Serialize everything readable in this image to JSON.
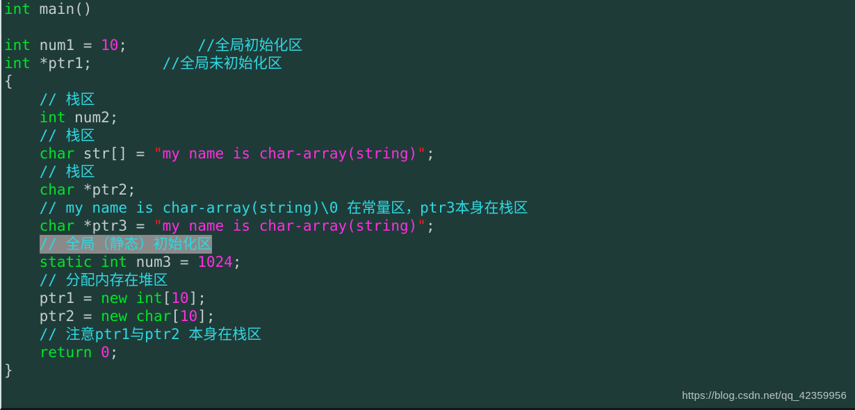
{
  "editor": {
    "language": "cpp",
    "background_color": "#1f3b38",
    "colors": {
      "keyword": "#00e52a",
      "identifier": "#c3cfcd",
      "number": "#ff2fe0",
      "string": "#ff2fe0",
      "quote": "#ff1a1a",
      "comment": "#2fd8e0",
      "selection": "#8a8a8a"
    }
  },
  "watermark": {
    "text": "https://blog.csdn.net/qq_42359956"
  },
  "code": {
    "lines": [
      {
        "n": 1,
        "highlight": false,
        "tokens": [
          {
            "t": "int",
            "c": "kw"
          },
          {
            "t": " ",
            "c": "pun"
          },
          {
            "t": "main()",
            "c": "id"
          }
        ]
      },
      {
        "n": 2,
        "highlight": false,
        "tokens": []
      },
      {
        "n": 3,
        "highlight": false,
        "tokens": [
          {
            "t": "int",
            "c": "kw"
          },
          {
            "t": " num1 ",
            "c": "id"
          },
          {
            "t": "= ",
            "c": "pun"
          },
          {
            "t": "10",
            "c": "num"
          },
          {
            "t": ";",
            "c": "pun"
          },
          {
            "t": "        ",
            "c": "pun"
          },
          {
            "t": "//全局初始化区",
            "c": "cmt"
          }
        ]
      },
      {
        "n": 4,
        "highlight": false,
        "tokens": [
          {
            "t": "int",
            "c": "kw"
          },
          {
            "t": " *ptr1;",
            "c": "id"
          },
          {
            "t": "        ",
            "c": "pun"
          },
          {
            "t": "//全局未初始化区",
            "c": "cmt"
          }
        ]
      },
      {
        "n": 5,
        "highlight": false,
        "tokens": [
          {
            "t": "{",
            "c": "brace"
          }
        ]
      },
      {
        "n": 6,
        "highlight": false,
        "tokens": [
          {
            "t": "    ",
            "c": "pun"
          },
          {
            "t": "// 栈区",
            "c": "cmt"
          }
        ]
      },
      {
        "n": 7,
        "highlight": false,
        "tokens": [
          {
            "t": "    ",
            "c": "pun"
          },
          {
            "t": "int",
            "c": "kw"
          },
          {
            "t": " num2;",
            "c": "id"
          }
        ]
      },
      {
        "n": 8,
        "highlight": false,
        "tokens": [
          {
            "t": "    ",
            "c": "pun"
          },
          {
            "t": "// 栈区",
            "c": "cmt"
          }
        ]
      },
      {
        "n": 9,
        "highlight": false,
        "tokens": [
          {
            "t": "    ",
            "c": "pun"
          },
          {
            "t": "char",
            "c": "kw"
          },
          {
            "t": " str[] ",
            "c": "id"
          },
          {
            "t": "= ",
            "c": "pun"
          },
          {
            "t": "\"",
            "c": "quo"
          },
          {
            "t": "my name is char-array(string)",
            "c": "str"
          },
          {
            "t": "\"",
            "c": "quo"
          },
          {
            "t": ";",
            "c": "pun"
          }
        ]
      },
      {
        "n": 10,
        "highlight": false,
        "tokens": [
          {
            "t": "    ",
            "c": "pun"
          },
          {
            "t": "// 栈区",
            "c": "cmt"
          }
        ]
      },
      {
        "n": 11,
        "highlight": false,
        "tokens": [
          {
            "t": "    ",
            "c": "pun"
          },
          {
            "t": "char",
            "c": "kw"
          },
          {
            "t": " *ptr2;",
            "c": "id"
          }
        ]
      },
      {
        "n": 12,
        "highlight": false,
        "tokens": [
          {
            "t": "    ",
            "c": "pun"
          },
          {
            "t": "// my name is char-array(string)\\0 在常量区，ptr3本身在栈区",
            "c": "cmt"
          }
        ]
      },
      {
        "n": 13,
        "highlight": false,
        "tokens": [
          {
            "t": "    ",
            "c": "pun"
          },
          {
            "t": "char",
            "c": "kw"
          },
          {
            "t": " *ptr3 ",
            "c": "id"
          },
          {
            "t": "= ",
            "c": "pun"
          },
          {
            "t": "\"",
            "c": "quo"
          },
          {
            "t": "my name is char-array(string)",
            "c": "str"
          },
          {
            "t": "\"",
            "c": "quo"
          },
          {
            "t": ";",
            "c": "pun"
          }
        ]
      },
      {
        "n": 14,
        "highlight": true,
        "tokens": [
          {
            "t": "    ",
            "c": "pun"
          },
          {
            "t": "// 全局（静态）初始化区",
            "c": "cmt",
            "hl": true
          }
        ]
      },
      {
        "n": 15,
        "highlight": false,
        "tokens": [
          {
            "t": "    ",
            "c": "pun"
          },
          {
            "t": "static int",
            "c": "kw"
          },
          {
            "t": " num3 ",
            "c": "id"
          },
          {
            "t": "= ",
            "c": "pun"
          },
          {
            "t": "1024",
            "c": "num"
          },
          {
            "t": ";",
            "c": "pun"
          }
        ]
      },
      {
        "n": 16,
        "highlight": false,
        "tokens": [
          {
            "t": "    ",
            "c": "pun"
          },
          {
            "t": "// 分配内存在堆区",
            "c": "cmt"
          }
        ]
      },
      {
        "n": 17,
        "highlight": false,
        "tokens": [
          {
            "t": "    ",
            "c": "pun"
          },
          {
            "t": "ptr1 ",
            "c": "id"
          },
          {
            "t": "= ",
            "c": "pun"
          },
          {
            "t": "new int",
            "c": "kw"
          },
          {
            "t": "[",
            "c": "pun"
          },
          {
            "t": "10",
            "c": "num"
          },
          {
            "t": "];",
            "c": "pun"
          }
        ]
      },
      {
        "n": 18,
        "highlight": false,
        "tokens": [
          {
            "t": "    ",
            "c": "pun"
          },
          {
            "t": "ptr2 ",
            "c": "id"
          },
          {
            "t": "= ",
            "c": "pun"
          },
          {
            "t": "new char",
            "c": "kw"
          },
          {
            "t": "[",
            "c": "pun"
          },
          {
            "t": "10",
            "c": "num"
          },
          {
            "t": "];",
            "c": "pun"
          }
        ]
      },
      {
        "n": 19,
        "highlight": false,
        "tokens": [
          {
            "t": "    ",
            "c": "pun"
          },
          {
            "t": "// 注意ptr1与ptr2 本身在栈区",
            "c": "cmt"
          }
        ]
      },
      {
        "n": 20,
        "highlight": false,
        "tokens": [
          {
            "t": "    ",
            "c": "pun"
          },
          {
            "t": "return",
            "c": "kw"
          },
          {
            "t": " ",
            "c": "pun"
          },
          {
            "t": "0",
            "c": "num"
          },
          {
            "t": ";",
            "c": "pun"
          }
        ]
      },
      {
        "n": 21,
        "highlight": false,
        "tokens": [
          {
            "t": "}",
            "c": "brace"
          }
        ]
      }
    ]
  }
}
